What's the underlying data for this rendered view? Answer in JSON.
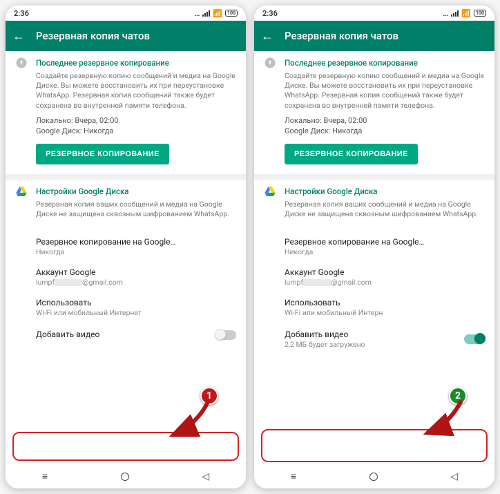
{
  "statusbar": {
    "time": "2:36",
    "battery": "100"
  },
  "appbar": {
    "title": "Резервная копия чатов"
  },
  "backup_section": {
    "header": "Последнее резервное копирование",
    "desc": "Создайте резервную копию сообщений и медиа на Google Диске. Вы можете восстановить их при переустановке WhatsApp. Резервная копия сообщений также будет сохранена во внутренней памяти телефона.",
    "local_line": "Локально: Вчера, 02:00",
    "drive_line": "Google Диск: Никогда",
    "button": "РЕЗЕРВНОЕ КОПИРОВАНИЕ"
  },
  "drive_section": {
    "header": "Настройки Google Диска",
    "desc": "Резервная копия ваших сообщений и медиа на Google Диске не защищена сквозным шифрованием WhatsApp."
  },
  "rows": {
    "freq_title": "Резервное копирование на Google…",
    "freq_sub": "Никогда",
    "account_title": "Аккаунт Google",
    "account_prefix": "lumpf",
    "account_suffix": "@gmail.com",
    "network_title": "Использовать",
    "network_sub_a": "Wi-Fi или мобильный Интернет",
    "network_sub_b": "Wi-Fi или мобильный Интерн",
    "video_title": "Добавить видео",
    "video_sub_on": "2,2 МБ будет загружено"
  },
  "callouts": {
    "one": "1",
    "two": "2"
  }
}
